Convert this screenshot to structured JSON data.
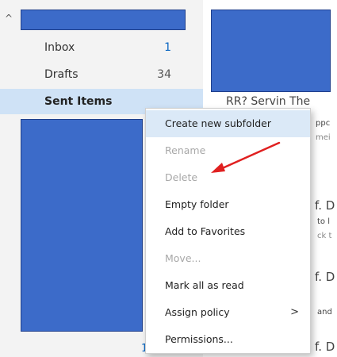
{
  "sidebar": {
    "folders": [
      {
        "label": "Inbox",
        "count": "1"
      },
      {
        "label": "Drafts",
        "count": "34"
      },
      {
        "label": "Sent Items",
        "count": ""
      }
    ]
  },
  "message_list_fragments": {
    "f1": "RR? Servin The",
    "f2": "ppc",
    "f3": "mei",
    "f4": "f. D",
    "f5": "to l",
    "f6": "ck t",
    "f7": "f. D",
    "f8": "and",
    "f9": "f. D",
    "f10": "1"
  },
  "context_menu": {
    "items": [
      {
        "label": "Create new subfolder",
        "state": "highlighted"
      },
      {
        "label": "Rename",
        "state": "disabled"
      },
      {
        "label": "Delete",
        "state": "disabled"
      },
      {
        "label": "Empty folder",
        "state": "enabled"
      },
      {
        "label": "Add to Favorites",
        "state": "enabled"
      },
      {
        "label": "Move...",
        "state": "disabled"
      },
      {
        "label": "Mark all as read",
        "state": "enabled"
      },
      {
        "label": "Assign policy",
        "state": "enabled",
        "submenu": ">"
      },
      {
        "label": "Permissions...",
        "state": "enabled"
      }
    ]
  },
  "colors": {
    "redaction": "#3c6bc9",
    "selection": "#cfe2f6",
    "menu_hover": "#dbe9f7",
    "annotation_arrow": "#e02020",
    "unread_count": "#0b66c2"
  },
  "icons": {
    "expand_caret": "chevron-up-icon"
  }
}
